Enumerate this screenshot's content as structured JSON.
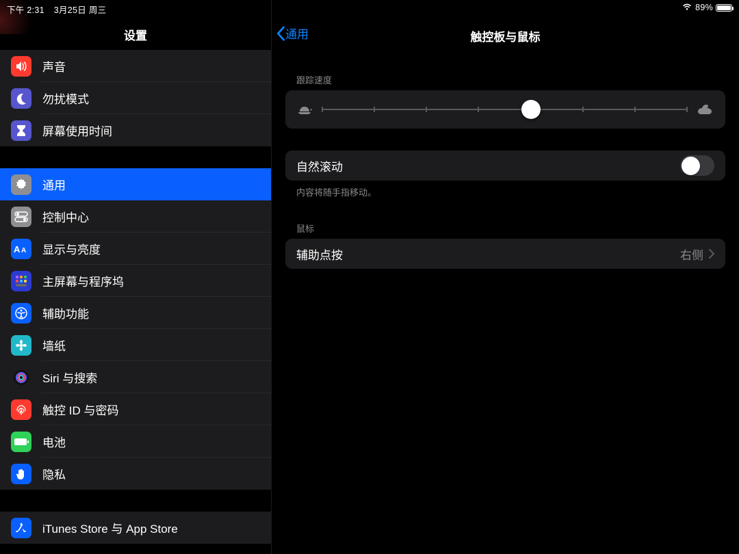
{
  "status": {
    "time": "下午 2:31",
    "date": "3月25日 周三",
    "battery_percent": "89%",
    "battery_fill_pct": 89
  },
  "sidebar": {
    "title": "设置",
    "groups": [
      {
        "items": [
          {
            "id": "sound",
            "label": "声音",
            "icon": "speaker",
            "bg": "#ff3b30"
          },
          {
            "id": "dnd",
            "label": "勿扰模式",
            "icon": "moon",
            "bg": "#5756ce"
          },
          {
            "id": "screen-time",
            "label": "屏幕使用时间",
            "icon": "hourglass",
            "bg": "#5756ce"
          }
        ]
      },
      {
        "items": [
          {
            "id": "general",
            "label": "通用",
            "icon": "gear",
            "bg": "#8e8e93",
            "selected": true
          },
          {
            "id": "control",
            "label": "控制中心",
            "icon": "switches",
            "bg": "#8e8e93"
          },
          {
            "id": "display",
            "label": "显示与亮度",
            "icon": "aa",
            "bg": "#0a60ff"
          },
          {
            "id": "home",
            "label": "主屏幕与程序坞",
            "icon": "grid",
            "bg": "#2b3bd3"
          },
          {
            "id": "accessibility",
            "label": "辅助功能",
            "icon": "access",
            "bg": "#0a60ff"
          },
          {
            "id": "wallpaper",
            "label": "墙纸",
            "icon": "flower",
            "bg": "#22b8c9"
          },
          {
            "id": "siri",
            "label": "Siri 与搜索",
            "icon": "siri",
            "bg": "#1c1c1e"
          },
          {
            "id": "touchid",
            "label": "触控 ID 与密码",
            "icon": "fingerprint",
            "bg": "#ff3b30"
          },
          {
            "id": "battery",
            "label": "电池",
            "icon": "battery",
            "bg": "#30d158"
          },
          {
            "id": "privacy",
            "label": "隐私",
            "icon": "hand",
            "bg": "#0a60ff"
          }
        ]
      },
      {
        "items": [
          {
            "id": "appstore",
            "label": "iTunes Store 与 App Store",
            "icon": "appstore",
            "bg": "#0a60ff"
          }
        ]
      }
    ]
  },
  "detail": {
    "back_label": "通用",
    "title": "触控板与鼠标",
    "sections": {
      "tracking": {
        "label": "跟踪速度",
        "min_icon": "turtle",
        "max_icon": "rabbit",
        "ticks": 8,
        "value_index": 4
      },
      "scroll": {
        "label": "自然滚动",
        "enabled": false,
        "footer": "内容将随手指移动。"
      },
      "mouse": {
        "header": "鼠标",
        "secondary_click_label": "辅助点按",
        "secondary_click_value": "右侧"
      }
    }
  }
}
